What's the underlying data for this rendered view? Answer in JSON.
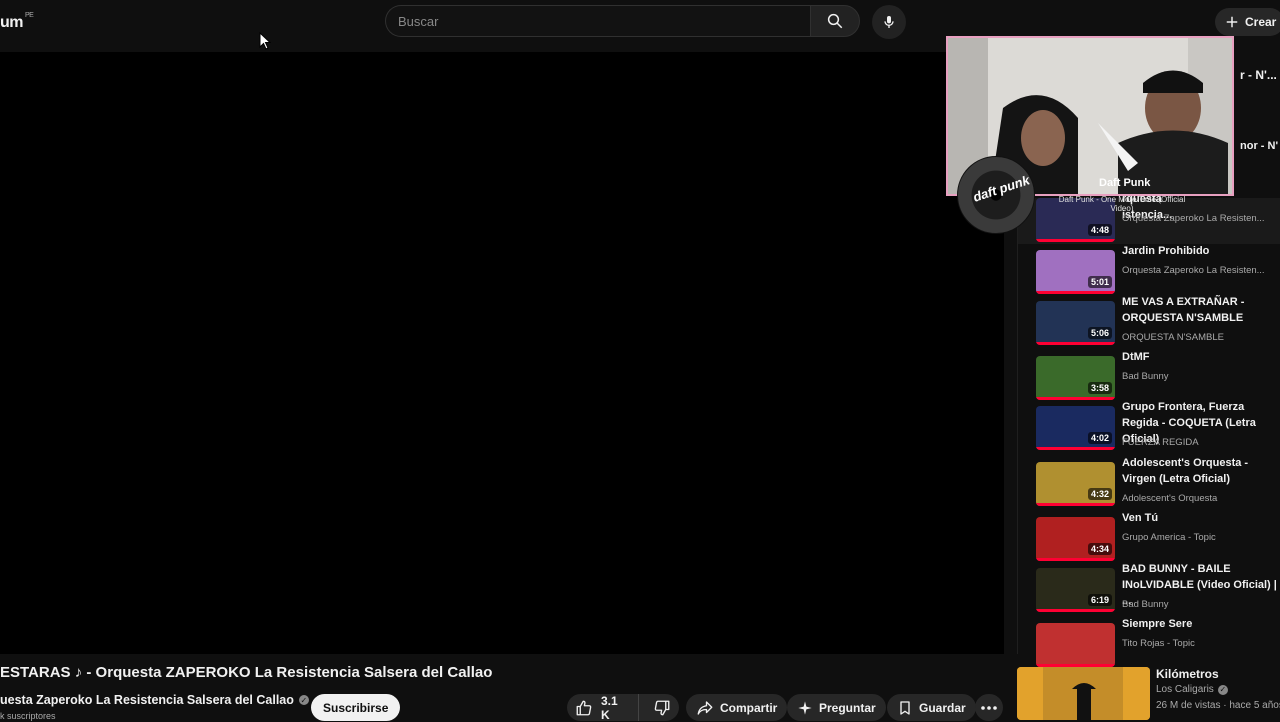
{
  "header": {
    "logo_text": "um",
    "logo_country": "PE",
    "search_placeholder": "Buscar",
    "create_label": "Crear"
  },
  "video": {
    "title": "ESTARAS ♪ - Orquesta ZAPEROKO La Resistencia Salsera del Callao",
    "channel": "uesta Zaperoko La Resistencia Salsera del Callao",
    "subscribers": "k suscriptores",
    "subscribe_label": "Suscribirse",
    "likes": "3.1 K",
    "share_label": "Compartir",
    "ask_label": "Preguntar",
    "save_label": "Guardar"
  },
  "sidebar": {
    "playlist_title_partial": "r - N'...",
    "playlist_sub_partial": "nor - N'",
    "items": [
      {
        "title": "rquesta\nistencia...",
        "channel": "Orquesta Zaperoko La Resisten...",
        "duration": "4:48",
        "color": "#2a2a55",
        "progress": 100
      },
      {
        "title": "Jardin Prohibido",
        "channel": "Orquesta Zaperoko La Resisten...",
        "duration": "5:01",
        "color": "#a070c0",
        "progress": 100
      },
      {
        "title": "ME VAS A EXTRAÑAR - ORQUESTA N'SAMBLE",
        "channel": "ORQUESTA N'SAMBLE",
        "duration": "5:06",
        "color": "#223355",
        "progress": 100
      },
      {
        "title": "DtMF",
        "channel": "Bad Bunny",
        "duration": "3:58",
        "color": "#3a6a2a",
        "progress": 100
      },
      {
        "title": "Grupo Frontera, Fuerza Regida - COQUETA (Letra Oficial)",
        "channel": "FUERZA REGIDA",
        "duration": "4:02",
        "color": "#1a2a60",
        "progress": 100
      },
      {
        "title": "Adolescent's Orquesta - Virgen (Letra Oficial)",
        "channel": "Adolescent's Orquesta",
        "duration": "4:32",
        "color": "#b09030",
        "progress": 100
      },
      {
        "title": "Ven Tú",
        "channel": "Grupo America - Topic",
        "duration": "4:34",
        "color": "#b02020",
        "progress": 100
      },
      {
        "title": "BAD BUNNY - BAILE INoLVIDABLE (Video Oficial) | ...",
        "channel": "Bad Bunny",
        "duration": "6:19",
        "color": "#2a2a1a",
        "progress": 100
      },
      {
        "title": "Siempre Sere",
        "channel": "Tito Rojas - Topic",
        "duration": "",
        "color": "#c03030",
        "progress": 100
      }
    ]
  },
  "next_video": {
    "title": "Kilómetros",
    "channel": "Los Caligaris",
    "meta": "26 M de vistas · hace 5 años"
  },
  "overlay": {
    "disc_text": "daft punk",
    "artist": "Daft Punk",
    "song": "Daft Punk - One More Time (Official Video)"
  }
}
